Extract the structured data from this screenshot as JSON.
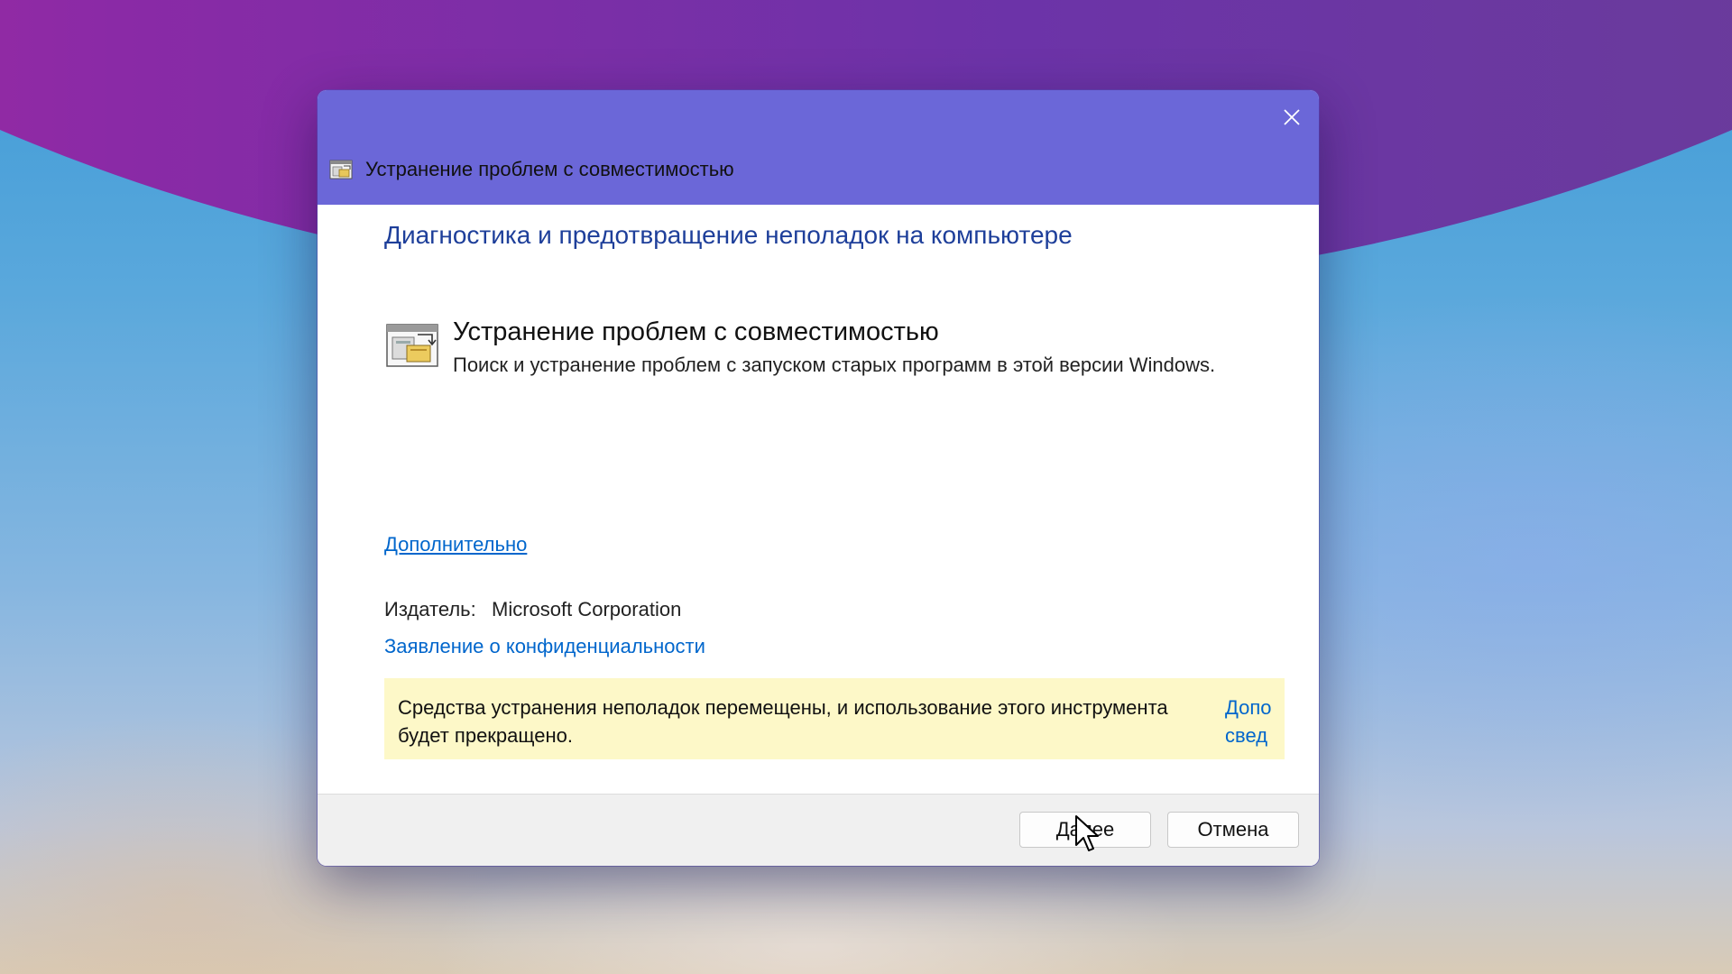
{
  "window": {
    "title": "Устранение проблем с совместимостью",
    "close_icon": "close-icon",
    "titlebar_color": "#6b67d8"
  },
  "content": {
    "heading": "Диагностика и предотвращение неполадок на компьютере",
    "tool": {
      "icon": "compatibility-troubleshooter-icon",
      "title": "Устранение проблем с совместимостью",
      "description": "Поиск и устранение проблем с запуском старых программ в этой версии Windows."
    },
    "more_link": "Дополнительно",
    "publisher_label": "Издатель:",
    "publisher_value": "Microsoft Corporation",
    "privacy_link": "Заявление о конфиденциальности",
    "notice": {
      "text": "Средства устранения неполадок перемещены, и использование этого инструмента будет прекращено.",
      "link_line1": "Допо",
      "link_line2": "свед",
      "background": "#fdf8c8"
    }
  },
  "footer": {
    "next_label": "Далее",
    "cancel_label": "Отмена"
  },
  "colors": {
    "heading": "#1e3f9a",
    "link": "#0066cc"
  }
}
